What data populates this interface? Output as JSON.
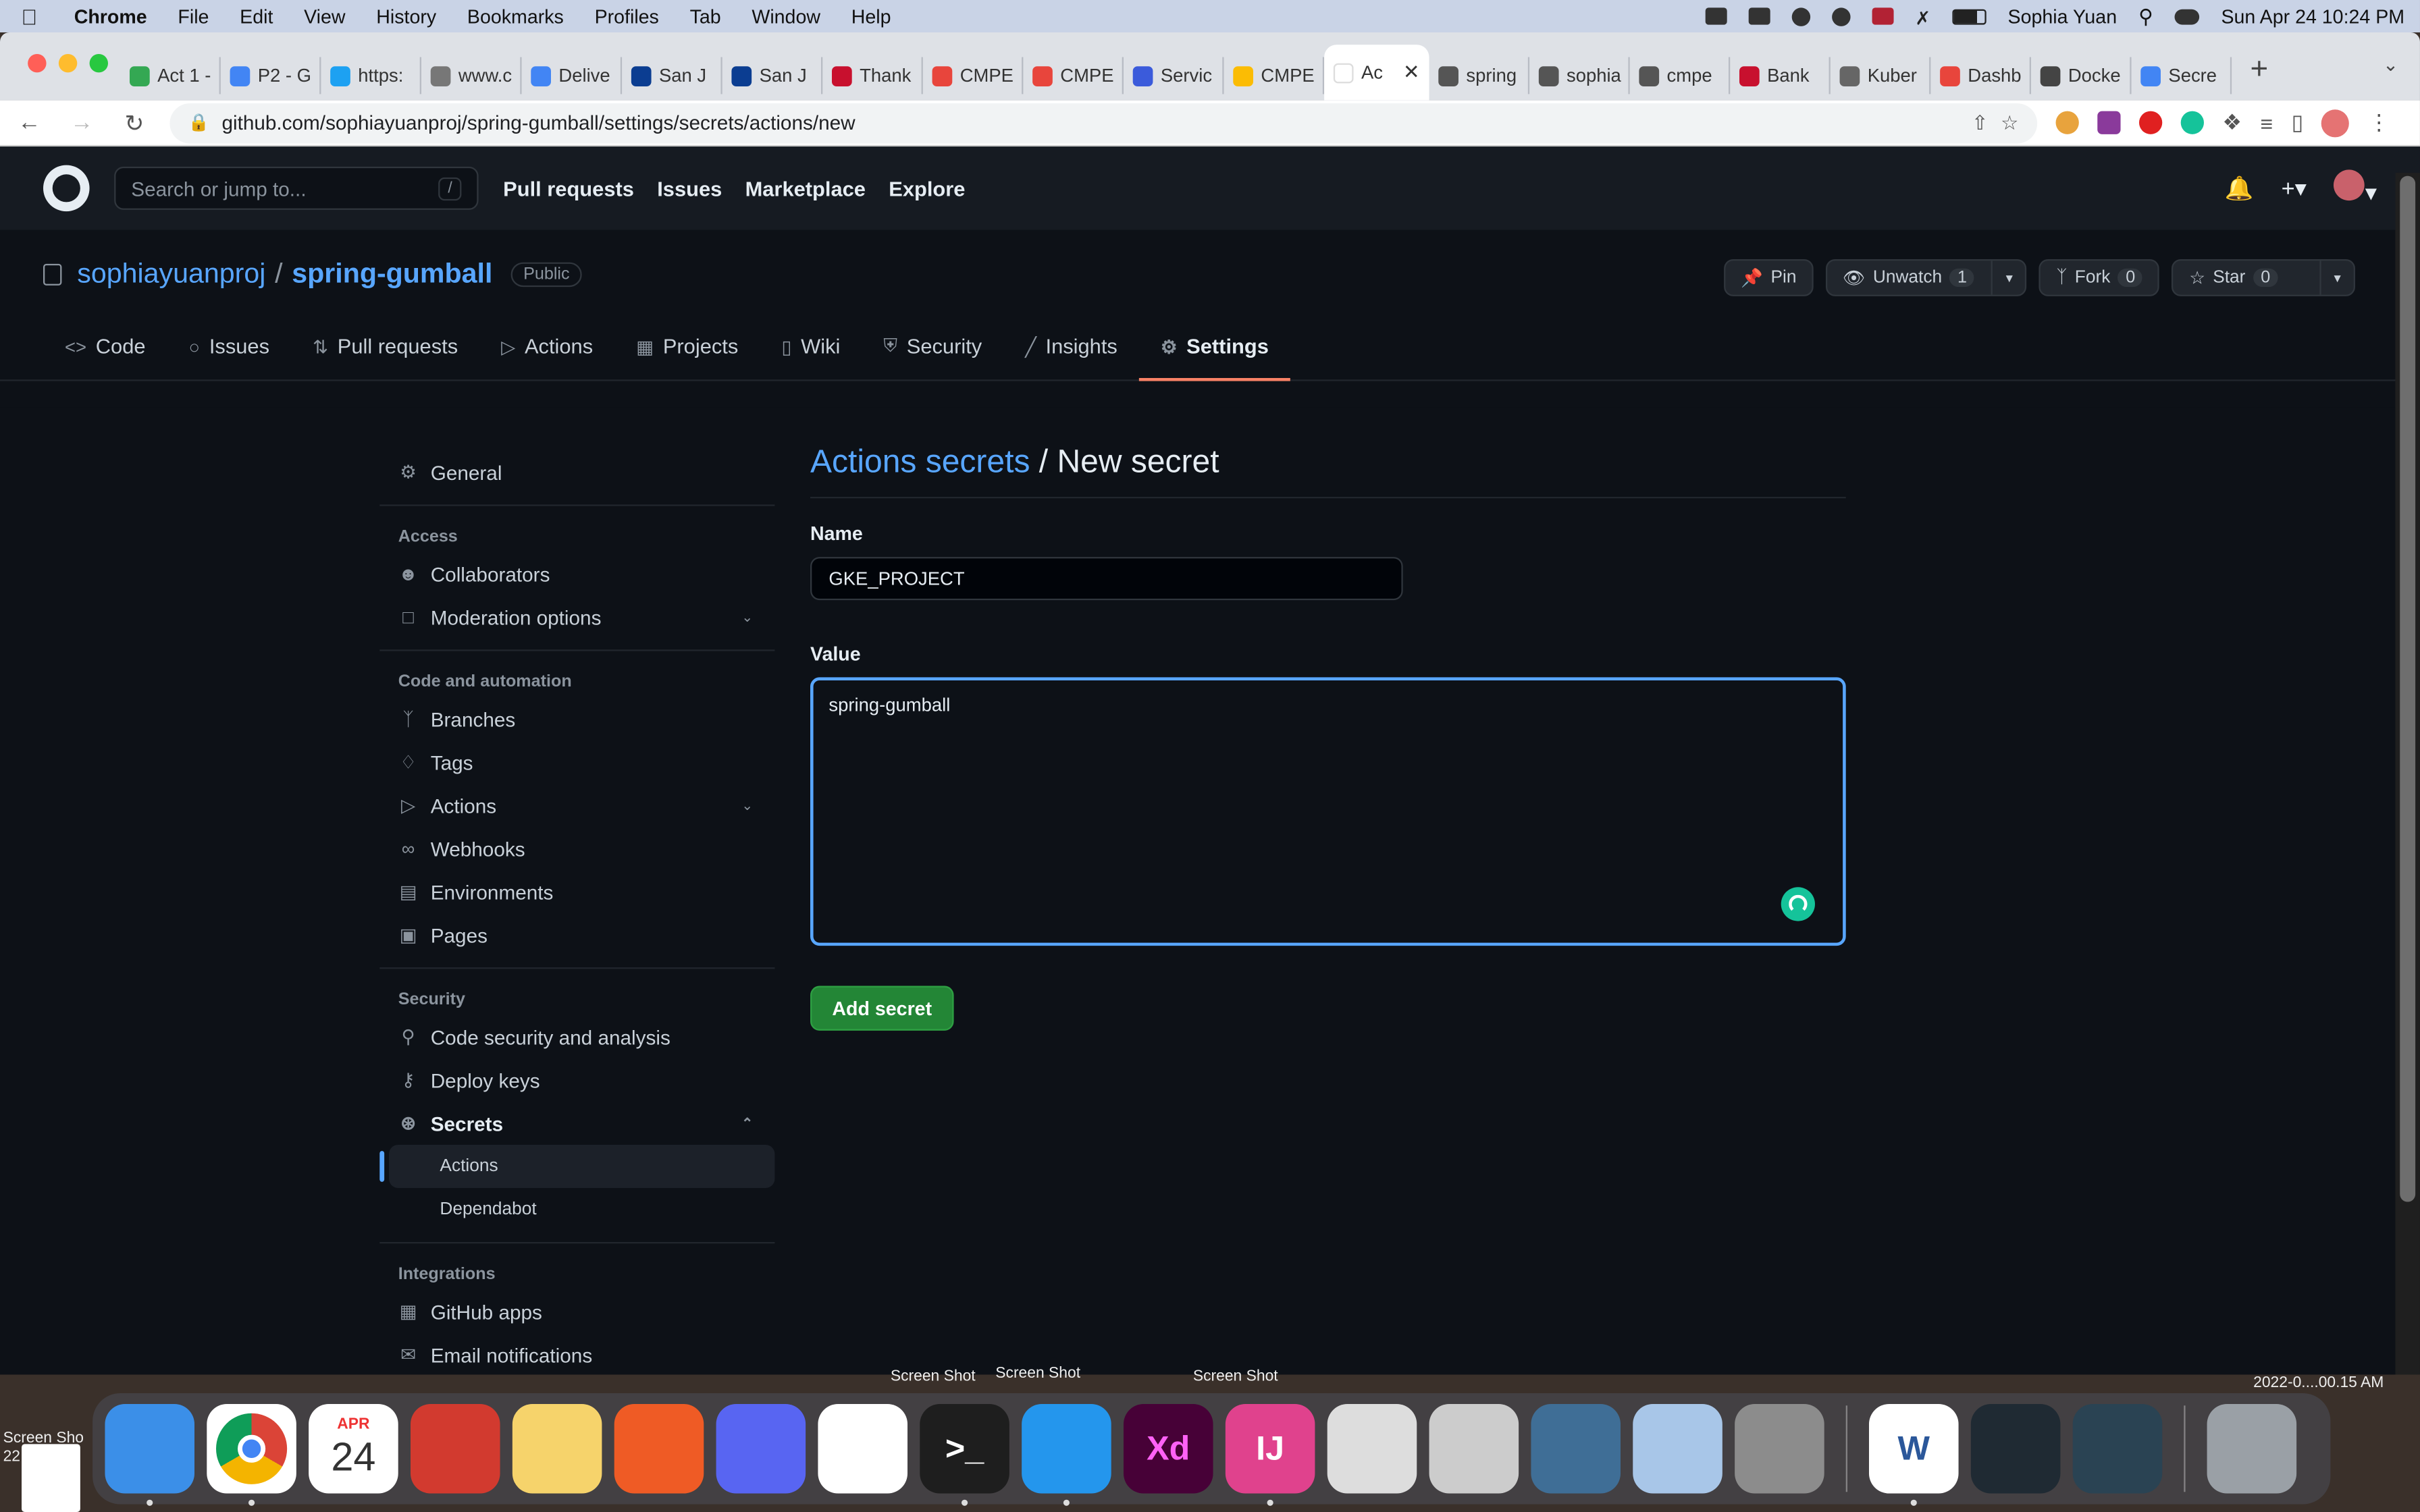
{
  "menubar": {
    "app": "Chrome",
    "items": [
      "File",
      "Edit",
      "View",
      "History",
      "Bookmarks",
      "Profiles",
      "Tab",
      "Window",
      "Help"
    ],
    "user": "Sophia Yuan",
    "datetime": "Sun Apr 24  10:24 PM"
  },
  "tabs": [
    {
      "label": "Act 1 -",
      "color": "#34a853"
    },
    {
      "label": "P2 - G",
      "color": "#4285f4"
    },
    {
      "label": "https:",
      "color": "#1da1f2"
    },
    {
      "label": "www.c",
      "color": "#777777"
    },
    {
      "label": "Delive",
      "color": "#4285f4"
    },
    {
      "label": "San J",
      "color": "#0b3d91"
    },
    {
      "label": "San J",
      "color": "#0b3d91"
    },
    {
      "label": "Thank",
      "color": "#c8102e"
    },
    {
      "label": "CMPE",
      "color": "#e8453c"
    },
    {
      "label": "CMPE",
      "color": "#e8453c"
    },
    {
      "label": "Servic",
      "color": "#3b5bdb"
    },
    {
      "label": "CMPE",
      "color": "#fbbc04"
    },
    {
      "label": "Ac",
      "color": "#ffffff",
      "active": true
    },
    {
      "label": "spring",
      "color": "#555555"
    },
    {
      "label": "sophia",
      "color": "#555555"
    },
    {
      "label": "cmpe",
      "color": "#555555"
    },
    {
      "label": "Bank",
      "color": "#c8102e"
    },
    {
      "label": "Kuber",
      "color": "#666666"
    },
    {
      "label": "Dashb",
      "color": "#e8453c"
    },
    {
      "label": "Docke",
      "color": "#444444"
    },
    {
      "label": "Secre",
      "color": "#4285f4"
    }
  ],
  "url": "github.com/sophiayuanproj/spring-gumball/settings/secrets/actions/new",
  "gh": {
    "search_placeholder": "Search or jump to...",
    "search_key": "/",
    "nav": [
      "Pull requests",
      "Issues",
      "Marketplace",
      "Explore"
    ],
    "owner": "sophiayuanproj",
    "repo": "spring-gumball",
    "visibility": "Public",
    "pin": "Pin",
    "unwatch": "Unwatch",
    "unwatch_count": "1",
    "fork": "Fork",
    "fork_count": "0",
    "star": "Star",
    "star_count": "0",
    "reponav": [
      {
        "label": "Code",
        "icon": "code-icon"
      },
      {
        "label": "Issues",
        "icon": "issue-icon"
      },
      {
        "label": "Pull requests",
        "icon": "pull-request-icon"
      },
      {
        "label": "Actions",
        "icon": "play-icon"
      },
      {
        "label": "Projects",
        "icon": "table-icon"
      },
      {
        "label": "Wiki",
        "icon": "book-icon"
      },
      {
        "label": "Security",
        "icon": "shield-icon"
      },
      {
        "label": "Insights",
        "icon": "graph-icon"
      },
      {
        "label": "Settings",
        "icon": "gear-icon",
        "active": true
      }
    ]
  },
  "sidebar": {
    "general": "General",
    "access_heading": "Access",
    "collaborators": "Collaborators",
    "moderation": "Moderation options",
    "code_heading": "Code and automation",
    "branches": "Branches",
    "tags": "Tags",
    "actions": "Actions",
    "webhooks": "Webhooks",
    "environments": "Environments",
    "pages": "Pages",
    "security_heading": "Security",
    "code_security": "Code security and analysis",
    "deploy_keys": "Deploy keys",
    "secrets": "Secrets",
    "secrets_actions": "Actions",
    "secrets_dependabot": "Dependabot",
    "integrations_heading": "Integrations",
    "github_apps": "GitHub apps",
    "email_notifications": "Email notifications"
  },
  "form": {
    "title_link": "Actions secrets",
    "title_rest": " / New secret",
    "name_label": "Name",
    "name_value": "GKE_PROJECT",
    "value_label": "Value",
    "value_value": "spring-gumball",
    "submit": "Add secret"
  },
  "desktop": {
    "label_left": "Screen Sho",
    "label_left2": "22",
    "label_1": "Screen Shot",
    "label_2": "Screen Shot",
    "label_3": "Screen Shot",
    "label_right": "2022-0....00.15 AM"
  },
  "dock": [
    {
      "name": "finder",
      "color": "#3b8fe8",
      "glyph": ""
    },
    {
      "name": "chrome",
      "color": "#ffffff",
      "glyph": ""
    },
    {
      "name": "calendar",
      "color": "#ffffff",
      "glyph": "24",
      "month": "APR"
    },
    {
      "name": "photo-booth",
      "color": "#d23a2f",
      "glyph": ""
    },
    {
      "name": "notes",
      "color": "#f6d36b",
      "glyph": ""
    },
    {
      "name": "postman",
      "color": "#ef5b25",
      "glyph": ""
    },
    {
      "name": "discord",
      "color": "#5865f2",
      "glyph": ""
    },
    {
      "name": "slack",
      "color": "#ffffff",
      "glyph": ""
    },
    {
      "name": "terminal",
      "color": "#1e1e1e",
      "glyph": ">_"
    },
    {
      "name": "docker",
      "color": "#2496ed",
      "glyph": ""
    },
    {
      "name": "adobe-xd",
      "color": "#470137",
      "glyph": "Xd"
    },
    {
      "name": "intellij",
      "color": "#e0428d",
      "glyph": "IJ"
    },
    {
      "name": "gimp",
      "color": "#dddddd",
      "glyph": ""
    },
    {
      "name": "unity",
      "color": "#cccccc",
      "glyph": ""
    },
    {
      "name": "mysql-workbench",
      "color": "#3f6e96",
      "glyph": ""
    },
    {
      "name": "preview",
      "color": "#a8c6e8",
      "glyph": ""
    },
    {
      "name": "system-preferences",
      "color": "#8c8c8c",
      "glyph": ""
    },
    {
      "name": "word",
      "color": "#ffffff",
      "glyph": "W"
    },
    {
      "name": "league-of-legends",
      "color": "#1f2a33",
      "glyph": ""
    },
    {
      "name": "league-client",
      "color": "#2a4353",
      "glyph": ""
    },
    {
      "name": "trash",
      "color": "#9aa0a6",
      "glyph": ""
    }
  ]
}
